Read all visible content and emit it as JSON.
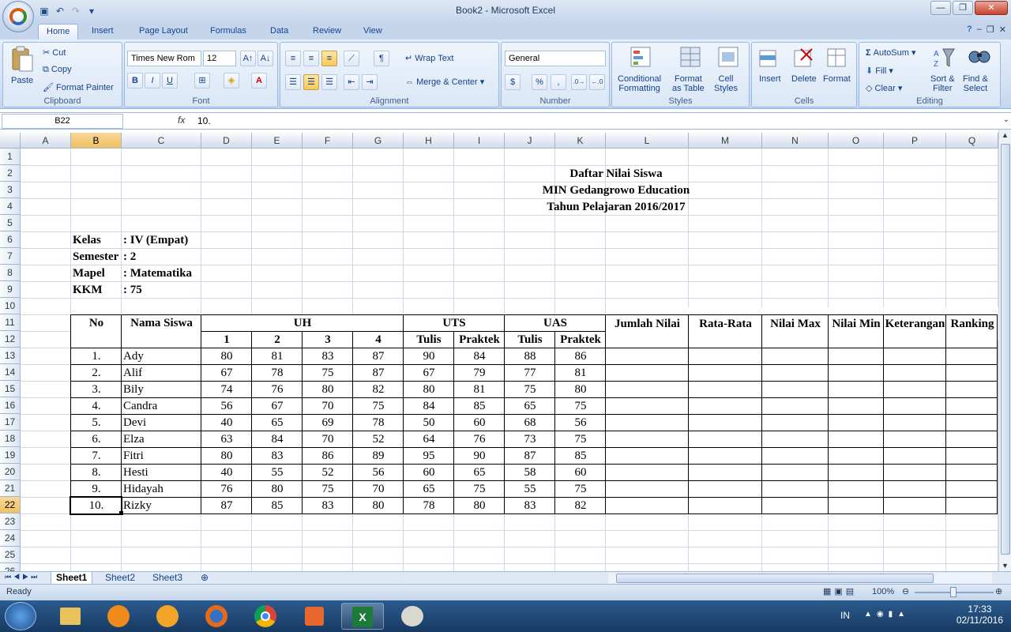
{
  "window": {
    "title": "Book2 - Microsoft Excel",
    "minimize": "—",
    "restore": "❐",
    "close": "✕"
  },
  "ribbon_tabs": [
    "Home",
    "Insert",
    "Page Layout",
    "Formulas",
    "Data",
    "Review",
    "View"
  ],
  "ribbon": {
    "clipboard": {
      "label": "Clipboard",
      "paste": "Paste",
      "cut": "Cut",
      "copy": "Copy",
      "format_painter": "Format Painter"
    },
    "font": {
      "label": "Font",
      "font_name": "Times New Rom",
      "font_size": "12",
      "bold": "B",
      "italic": "I",
      "underline": "U"
    },
    "alignment": {
      "label": "Alignment",
      "wrap_text": "Wrap Text",
      "merge_center": "Merge & Center"
    },
    "number": {
      "label": "Number",
      "format": "General",
      "percent": "%",
      "comma": ","
    },
    "styles": {
      "label": "Styles",
      "conditional_1": "Conditional",
      "conditional_2": "Formatting",
      "format_1": "Format",
      "format_2": "as Table",
      "cell_1": "Cell",
      "cell_2": "Styles"
    },
    "cells": {
      "label": "Cells",
      "insert": "Insert",
      "delete": "Delete",
      "format": "Format"
    },
    "editing": {
      "label": "Editing",
      "autosum": "AutoSum",
      "fill": "Fill",
      "clear": "Clear",
      "sort_1": "Sort &",
      "sort_2": "Filter",
      "find_1": "Find &",
      "find_2": "Select"
    }
  },
  "formula_bar": {
    "name_box": "B22",
    "fx": "fx",
    "value": "10."
  },
  "columns": [
    "A",
    "B",
    "C",
    "D",
    "E",
    "F",
    "G",
    "H",
    "I",
    "J",
    "K",
    "L",
    "M",
    "N",
    "O",
    "P",
    "Q"
  ],
  "rows": [
    "1",
    "2",
    "3",
    "4",
    "5",
    "6",
    "7",
    "8",
    "9",
    "10",
    "11",
    "12",
    "13",
    "14",
    "15",
    "16",
    "17",
    "18",
    "19",
    "20",
    "21",
    "22",
    "23",
    "24",
    "25",
    "26"
  ],
  "sheet": {
    "title1": "Daftar Nilai Siswa",
    "title2": "MIN Gedangrowo Education",
    "title3": "Tahun Pelajaran 2016/2017",
    "info": [
      {
        "label": "Kelas",
        "value": ": IV (Empat)"
      },
      {
        "label": "Semester",
        "value": ": 2"
      },
      {
        "label": "Mapel",
        "value": ": Matematika"
      },
      {
        "label": "KKM",
        "value": ": 75"
      }
    ],
    "headers": {
      "no": "No",
      "nama": "Nama Siswa",
      "uh": "UH",
      "uts": "UTS",
      "uas": "UAS",
      "uh1": "1",
      "uh2": "2",
      "uh3": "3",
      "uh4": "4",
      "uts_tulis": "Tulis",
      "uts_praktek": "Praktek",
      "uas_tulis": "Tulis",
      "uas_praktek": "Praktek",
      "jumlah": "Jumlah Nilai",
      "rata": "Rata-Rata",
      "max": "Nilai Max",
      "min": "Nilai Min",
      "ket": "Keterangan",
      "rank": "Ranking"
    },
    "students": [
      {
        "no": "1.",
        "nama": "Ady",
        "uh1": "80",
        "uh2": "81",
        "uh3": "83",
        "uh4": "87",
        "uts_t": "90",
        "uts_p": "84",
        "uas_t": "88",
        "uas_p": "86"
      },
      {
        "no": "2.",
        "nama": "Alif",
        "uh1": "67",
        "uh2": "78",
        "uh3": "75",
        "uh4": "87",
        "uts_t": "67",
        "uts_p": "79",
        "uas_t": "77",
        "uas_p": "81"
      },
      {
        "no": "3.",
        "nama": "Bily",
        "uh1": "74",
        "uh2": "76",
        "uh3": "80",
        "uh4": "82",
        "uts_t": "80",
        "uts_p": "81",
        "uas_t": "75",
        "uas_p": "80"
      },
      {
        "no": "4.",
        "nama": "Candra",
        "uh1": "56",
        "uh2": "67",
        "uh3": "70",
        "uh4": "75",
        "uts_t": "84",
        "uts_p": "85",
        "uas_t": "65",
        "uas_p": "75"
      },
      {
        "no": "5.",
        "nama": "Devi",
        "uh1": "40",
        "uh2": "65",
        "uh3": "69",
        "uh4": "78",
        "uts_t": "50",
        "uts_p": "60",
        "uas_t": "68",
        "uas_p": "56"
      },
      {
        "no": "6.",
        "nama": "Elza",
        "uh1": "63",
        "uh2": "84",
        "uh3": "70",
        "uh4": "52",
        "uts_t": "64",
        "uts_p": "76",
        "uas_t": "73",
        "uas_p": "75"
      },
      {
        "no": "7.",
        "nama": "Fitri",
        "uh1": "80",
        "uh2": "83",
        "uh3": "86",
        "uh4": "89",
        "uts_t": "95",
        "uts_p": "90",
        "uas_t": "87",
        "uas_p": "85"
      },
      {
        "no": "8.",
        "nama": "Hesti",
        "uh1": "40",
        "uh2": "55",
        "uh3": "52",
        "uh4": "56",
        "uts_t": "60",
        "uts_p": "65",
        "uas_t": "58",
        "uas_p": "60"
      },
      {
        "no": "9.",
        "nama": "Hidayah",
        "uh1": "76",
        "uh2": "80",
        "uh3": "75",
        "uh4": "70",
        "uts_t": "65",
        "uts_p": "75",
        "uas_t": "55",
        "uas_p": "75"
      },
      {
        "no": "10.",
        "nama": "Rizky",
        "uh1": "87",
        "uh2": "85",
        "uh3": "83",
        "uh4": "80",
        "uts_t": "78",
        "uts_p": "80",
        "uas_t": "83",
        "uas_p": "82"
      }
    ]
  },
  "sheet_tabs": [
    "Sheet1",
    "Sheet2",
    "Sheet3"
  ],
  "status": {
    "ready": "Ready",
    "zoom": "100%"
  },
  "taskbar": {
    "lang": "IN",
    "time": "17:33",
    "date": "02/11/2016"
  },
  "colors": {
    "ribbon": "#d1e0f3",
    "selected_header": "#f1c15f",
    "taskbar": "#173a63"
  }
}
